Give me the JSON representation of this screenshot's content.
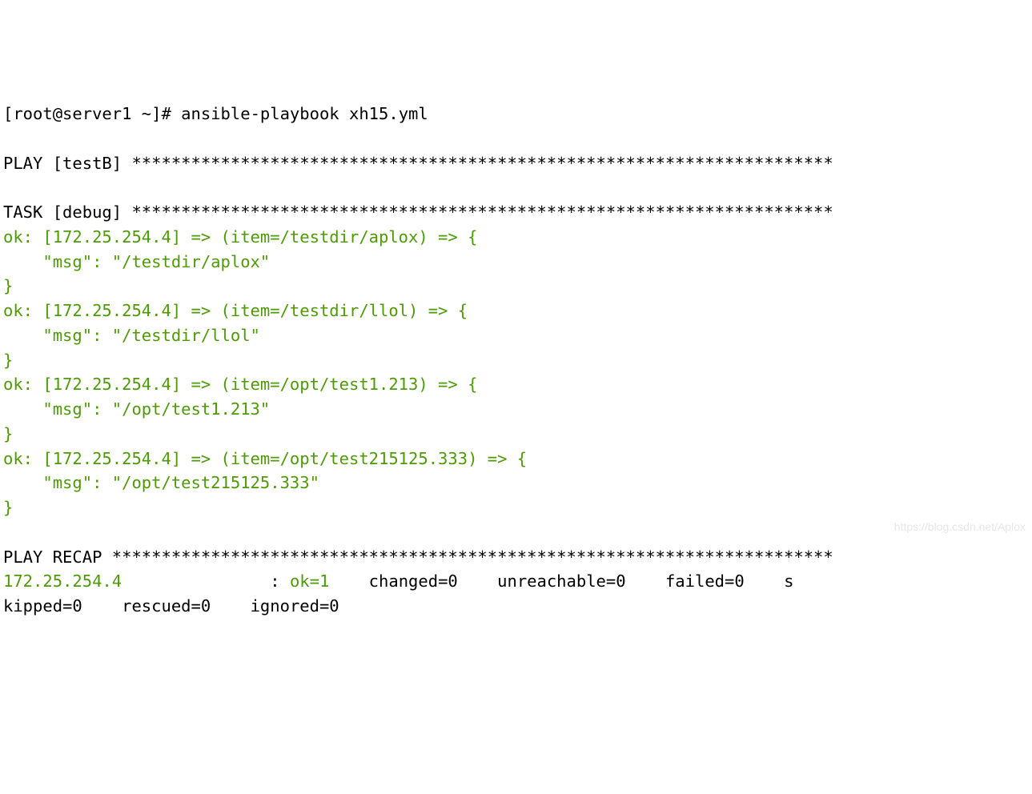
{
  "prompt": {
    "user_host": "[root@server1 ~]#",
    "command": "ansible-playbook xh15.yml"
  },
  "play_header": "PLAY [testB] ***********************************************************************",
  "task_header": "TASK [debug] ***********************************************************************",
  "task_items": [
    {
      "header": "ok: [172.25.254.4] => (item=/testdir/aplox) => {",
      "msg_key": "    \"msg\": \"/testdir/aplox\"",
      "close": "}"
    },
    {
      "header": "ok: [172.25.254.4] => (item=/testdir/llol) => {",
      "msg_key": "    \"msg\": \"/testdir/llol\"",
      "close": "}"
    },
    {
      "header": "ok: [172.25.254.4] => (item=/opt/test1.213) => {",
      "msg_key": "    \"msg\": \"/opt/test1.213\"",
      "close": "}"
    },
    {
      "header": "ok: [172.25.254.4] => (item=/opt/test215125.333) => {",
      "msg_key": "    \"msg\": \"/opt/test215125.333\"",
      "close": "}"
    }
  ],
  "recap_header": "PLAY RECAP *************************************************************************",
  "recap": {
    "host": "172.25.254.4",
    "sep": "               : ",
    "ok": "ok=1",
    "changed": "    changed=0",
    "unreachable": "    unreachable=0",
    "failed": "    failed=0",
    "skipped_line1": "    s",
    "skipped_line2": "kipped=0",
    "rescued": "    rescued=0",
    "ignored": "    ignored=0"
  },
  "watermark": "https://blog.csdn.net/Aplox"
}
